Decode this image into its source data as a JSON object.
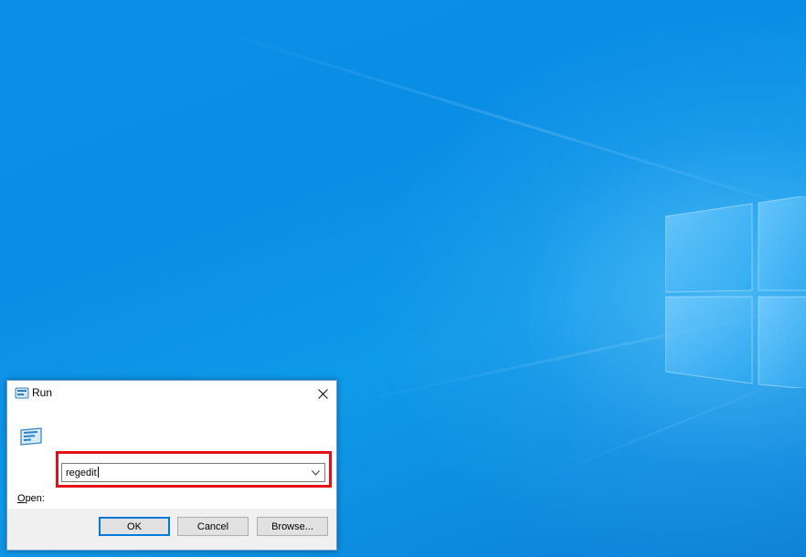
{
  "dialog": {
    "title": "Run",
    "open_label_accel": "O",
    "open_label_rest": "pen:",
    "open_value": "regedit",
    "ok_label": "OK",
    "cancel_label": "Cancel",
    "browse_label": "Browse..."
  },
  "colors": {
    "desktop_blue": "#0b8fe6",
    "highlight_red": "#e3101a",
    "accent_blue": "#0078d7"
  },
  "icons": {
    "title_icon": "run-icon",
    "close_icon": "close-icon",
    "dropdown_icon": "chevron-down-icon",
    "logo": "windows-logo"
  }
}
